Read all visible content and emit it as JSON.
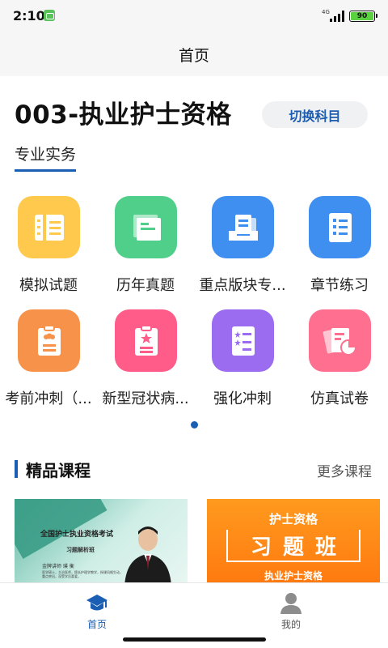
{
  "status_bar": {
    "time": "2:10",
    "network": "4G",
    "battery": "90"
  },
  "nav": {
    "title": "首页"
  },
  "header": {
    "subject_title": "003-执业护士资格",
    "switch_label": "切换科目",
    "category_tab": "专业实务"
  },
  "colors": {
    "accent": "#1a5fb4",
    "tile_yellow": "#ffc94d",
    "tile_green": "#4fcf8a",
    "tile_blue": "#3e8ff0",
    "tile_orange": "#f7924a",
    "tile_pink": "#ff5c8a",
    "tile_purple": "#9b6cf0",
    "tile_rose": "#ff6f8f"
  },
  "grid": {
    "items": [
      {
        "label": "模拟试题",
        "icon": "ledger-icon",
        "color": "#ffc94d"
      },
      {
        "label": "历年真题",
        "icon": "book-icon",
        "color": "#4fcf8a"
      },
      {
        "label": "重点版块专...",
        "icon": "inbox-icon",
        "color": "#3e8ff0"
      },
      {
        "label": "章节练习",
        "icon": "list-icon",
        "color": "#3e8ff0"
      },
      {
        "label": "考前冲刺（...",
        "icon": "clipboard-people-icon",
        "color": "#f7924a"
      },
      {
        "label": "新型冠状病...",
        "icon": "clipboard-star-icon",
        "color": "#ff5c8a"
      },
      {
        "label": "强化冲刺",
        "icon": "star-list-icon",
        "color": "#9b6cf0"
      },
      {
        "label": "仿真试卷",
        "icon": "paper-chart-icon",
        "color": "#ff6f8f"
      }
    ]
  },
  "courses": {
    "section_title": "精品课程",
    "more_label": "更多课程",
    "card1": {
      "title": "全国护士执业资格考试",
      "subtitle": "习题解析班",
      "teacher": "金牌讲师 璞 衡",
      "desc": "医学硕士，主治医师，擅长护理学教学，授课风格生动，重点突出，深受学员喜爱。"
    },
    "card2": {
      "top": "护士资格",
      "main": "习题班",
      "bottom": "执业护士资格"
    }
  },
  "bottom_nav": {
    "home": "首页",
    "mine": "我的"
  }
}
